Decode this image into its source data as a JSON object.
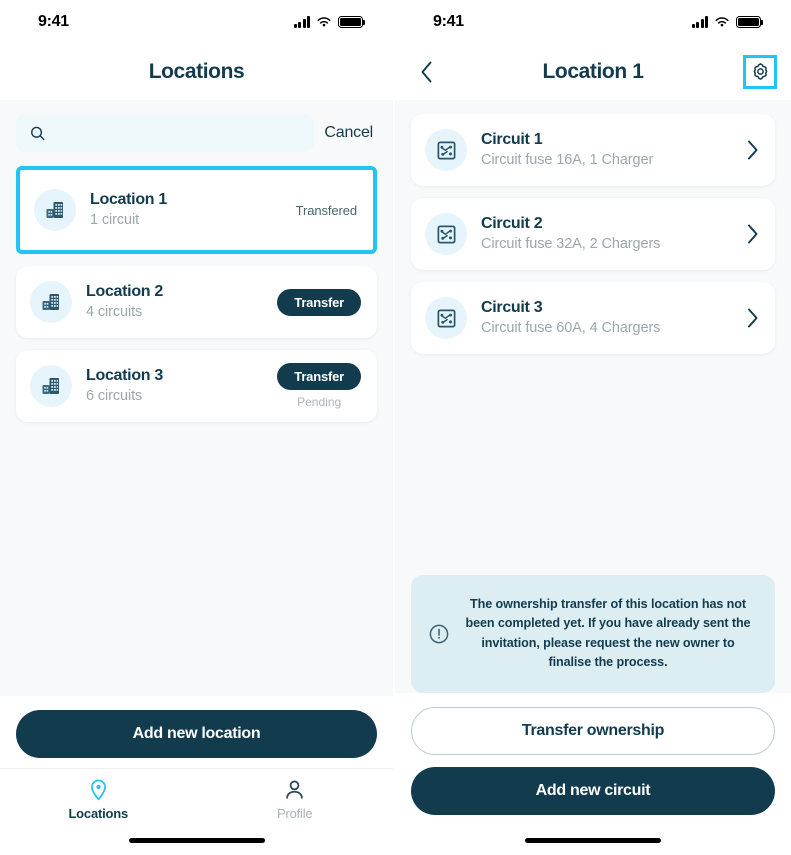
{
  "status_bar": {
    "time": "9:41",
    "signal_icon": "cellular-signal-icon",
    "wifi_icon": "wifi-icon",
    "battery_icon": "battery-full-icon"
  },
  "colors": {
    "brand_dark": "#123c4e",
    "accent_cyan": "#22c3f5",
    "icon_bg": "#e6f5fb",
    "search_bg": "#eff8fa",
    "banner_bg": "#ddeef3",
    "muted_text": "#9aa8ae",
    "screen_bg": "#f8f9fa"
  },
  "left_screen": {
    "nav": {
      "title": "Locations"
    },
    "search": {
      "value": "",
      "placeholder": "",
      "icon": "search-icon",
      "cancel_label": "Cancel"
    },
    "locations": [
      {
        "name": "Location 1",
        "subtitle": "1 circuit",
        "icon": "building-icon",
        "status_text": "Transfered",
        "action_label": "",
        "action_sub": "",
        "selected": true
      },
      {
        "name": "Location 2",
        "subtitle": "4 circuits",
        "icon": "building-icon",
        "status_text": "",
        "action_label": "Transfer",
        "action_sub": "",
        "selected": false
      },
      {
        "name": "Location 3",
        "subtitle": "6 circuits",
        "icon": "building-icon",
        "status_text": "",
        "action_label": "Transfer",
        "action_sub": "Pending",
        "selected": false
      }
    ],
    "primary_button": "Add new location",
    "tabs": [
      {
        "label": "Locations",
        "icon": "map-pin-icon",
        "active": true
      },
      {
        "label": "Profile",
        "icon": "person-icon",
        "active": false
      }
    ]
  },
  "right_screen": {
    "nav": {
      "back_icon": "chevron-left-icon",
      "title": "Location 1",
      "gear_icon": "gear-icon",
      "gear_highlighted": true
    },
    "circuits": [
      {
        "name": "Circuit 1",
        "subtitle": "Circuit fuse 16A, 1 Charger",
        "icon": "circuit-icon",
        "chevron": "chevron-right-icon"
      },
      {
        "name": "Circuit 2",
        "subtitle": "Circuit fuse 32A, 2 Chargers",
        "icon": "circuit-icon",
        "chevron": "chevron-right-icon"
      },
      {
        "name": "Circuit 3",
        "subtitle": "Circuit fuse 60A, 4 Chargers",
        "icon": "circuit-icon",
        "chevron": "chevron-right-icon"
      }
    ],
    "banner": {
      "icon": "exclamation-circle-icon",
      "text": "The ownership transfer of this location has not been completed yet. If you have already sent the invitation, please request the new owner to finalise the process."
    },
    "secondary_button": "Transfer ownership",
    "primary_button": "Add new circuit"
  }
}
